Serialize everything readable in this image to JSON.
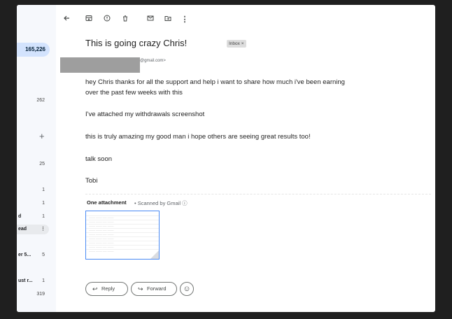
{
  "sidebar": {
    "inbox_count": "165,226",
    "rows": [
      {
        "label": "",
        "count": "262"
      },
      {
        "label": "",
        "count": "25"
      },
      {
        "label": "",
        "count": "1"
      },
      {
        "label": "",
        "count": "1"
      },
      {
        "label": "d",
        "count": "1"
      },
      {
        "label": "ead",
        "count": ""
      },
      {
        "label": "er 5...",
        "count": "5"
      },
      {
        "label": "ust r...",
        "count": "1"
      },
      {
        "label": "",
        "count": "319"
      }
    ],
    "plus": "+"
  },
  "email": {
    "subject": "This is going crazy Chris!",
    "badge": "Inbox ×",
    "sender_suffix": "@gmail.com>",
    "lines": [
      "hey Chris thanks for all the support and help i want to share how much i've been earning",
      "over the past few weeks with this",
      "I've attached my withdrawals screenshot",
      "this is truly amazing my good man i hope others are seeing great results too!",
      "talk soon",
      "Tobi"
    ]
  },
  "attachments": {
    "title": "One attachment",
    "scan_note": "• Scanned by Gmail",
    "info_icon": "ⓘ"
  },
  "actions": {
    "reply": "Reply",
    "forward": "Forward"
  },
  "icons": {
    "back": "back-arrow-icon",
    "archive": "archive-icon",
    "spam": "report-spam-icon",
    "delete": "delete-icon",
    "unread": "mark-unread-icon",
    "move": "move-to-icon",
    "more": "more-vert-icon"
  }
}
